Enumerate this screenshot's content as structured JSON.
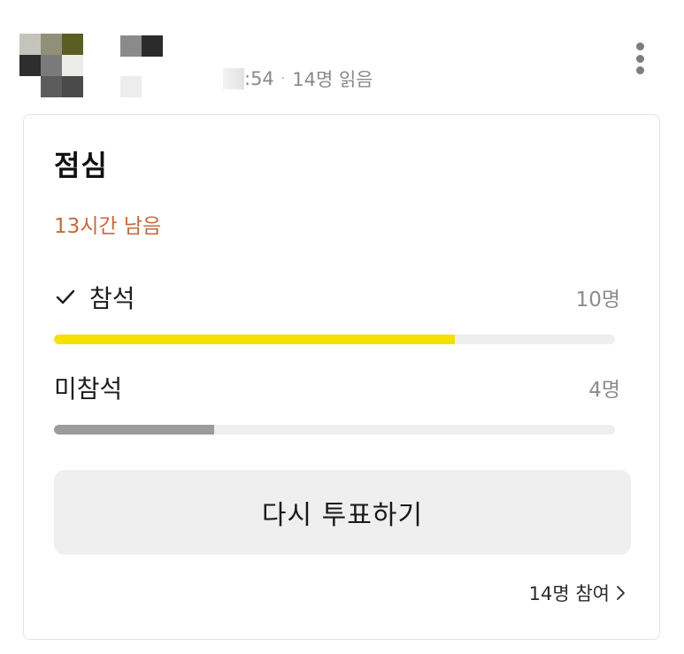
{
  "header": {
    "meta_time": ":54",
    "meta_separator": "·",
    "meta_read": "14명 읽음",
    "more_icon": "more-vertical-icon"
  },
  "poll": {
    "title": "점심",
    "remaining": "13시간 남음",
    "options": [
      {
        "label": "참석",
        "count": "10명",
        "selected": true,
        "fraction": 0.714,
        "bar_color": "#f5e000"
      },
      {
        "label": "미참석",
        "count": "4명",
        "selected": false,
        "fraction": 0.286,
        "bar_color": "#9b9b9b"
      }
    ],
    "revote_label": "다시 투표하기",
    "participants_label": "14명 참여"
  },
  "colors": {
    "remaining_text": "#c8683f",
    "selected_bar": "#f5e000",
    "unselected_bar": "#9b9b9b",
    "track": "#eeeeee"
  }
}
